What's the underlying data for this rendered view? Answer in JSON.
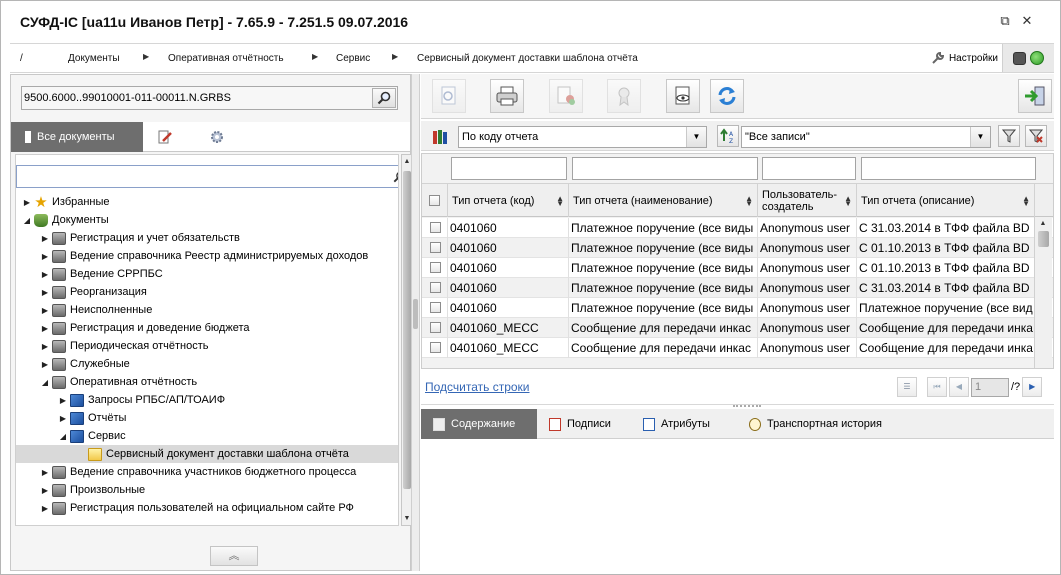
{
  "window": {
    "title": "СУФД-IC [ua11u Иванов Петр] - 7.65.9 - 7.251.5 09.07.2016",
    "restore_glyph": "⧉",
    "close_glyph": "✕"
  },
  "breadcrumb": {
    "items": [
      "/",
      "Документы",
      "Оперативная отчётность",
      "Сервис",
      "Сервисный документ доставки шаблона отчёта"
    ],
    "settings_label": "Настройки"
  },
  "left": {
    "path_value": "9500.6000..99010001-011-00011.N.GRBS",
    "tab_all_docs": "Все документы",
    "tree": [
      {
        "label": "Избранные",
        "level": 0,
        "arrow": "▶",
        "icon": "star"
      },
      {
        "label": "Документы",
        "level": 0,
        "arrow": "◢",
        "icon": "db"
      },
      {
        "label": "Регистрация и учет обязательств",
        "level": 1,
        "arrow": "▶",
        "icon": "box"
      },
      {
        "label": "Ведение справочника Реестр администрируемых доходов",
        "level": 1,
        "arrow": "▶",
        "icon": "box"
      },
      {
        "label": "Ведение СРРПБС",
        "level": 1,
        "arrow": "▶",
        "icon": "box"
      },
      {
        "label": "Реорганизация",
        "level": 1,
        "arrow": "▶",
        "icon": "box"
      },
      {
        "label": "Неисполненные",
        "level": 1,
        "arrow": "▶",
        "icon": "box"
      },
      {
        "label": "Регистрация и доведение бюджета",
        "level": 1,
        "arrow": "▶",
        "icon": "box"
      },
      {
        "label": "Периодическая отчётность",
        "level": 1,
        "arrow": "▶",
        "icon": "box"
      },
      {
        "label": "Служебные",
        "level": 1,
        "arrow": "▶",
        "icon": "box"
      },
      {
        "label": "Оперативная отчётность",
        "level": 1,
        "arrow": "◢",
        "icon": "box"
      },
      {
        "label": "Запросы РПБС/АП/ТОАИФ",
        "level": 2,
        "arrow": "▶",
        "icon": "book"
      },
      {
        "label": "Отчёты",
        "level": 2,
        "arrow": "▶",
        "icon": "book"
      },
      {
        "label": "Сервис",
        "level": 2,
        "arrow": "◢",
        "icon": "book"
      },
      {
        "label": "Сервисный документ доставки шаблона отчёта",
        "level": 3,
        "arrow": "",
        "icon": "folder",
        "selected": true
      },
      {
        "label": "Ведение справочника участников бюджетного процесса",
        "level": 1,
        "arrow": "▶",
        "icon": "box"
      },
      {
        "label": "Произвольные",
        "level": 1,
        "arrow": "▶",
        "icon": "box"
      },
      {
        "label": "Регистрация пользователей на официальном сайте РФ",
        "level": 1,
        "arrow": "▶",
        "icon": "box"
      }
    ],
    "collapse_glyph": "︽"
  },
  "right": {
    "sort_select": "По коду отчета",
    "records_select": "\"Все записи\"",
    "columns": [
      "Тип отчета (код)",
      "Тип отчета (наименование)",
      "Пользователь-создатель",
      "Тип отчета (описание)"
    ],
    "rows": [
      [
        "0401060",
        "Платежное поручение (все виды",
        "Anonymous user",
        "С 31.03.2014 в ТФФ файла BD"
      ],
      [
        "0401060",
        "Платежное поручение (все виды",
        "Anonymous user",
        "С 01.10.2013 в ТФФ файла BD"
      ],
      [
        "0401060",
        "Платежное поручение (все виды",
        "Anonymous user",
        "С 01.10.2013 в ТФФ файла BD"
      ],
      [
        "0401060",
        "Платежное поручение (все виды",
        "Anonymous user",
        "С 31.03.2014 в ТФФ файла BD"
      ],
      [
        "0401060",
        "Платежное поручение (все виды",
        "Anonymous user",
        "Платежное поручение (все вид"
      ],
      [
        "0401060_MECC",
        "Сообщение для передачи инкас",
        "Anonymous user",
        "Сообщение для передачи инка"
      ],
      [
        "0401060_MECC",
        "Сообщение для передачи инкас",
        "Anonymous user",
        "Сообщение для передачи инка"
      ]
    ],
    "count_rows_link": "Подсчитать строки",
    "page_value": "1",
    "page_total": "/?",
    "bottom_tabs": [
      "Содержание",
      "Подписи",
      "Атрибуты",
      "Транспортная история"
    ]
  }
}
